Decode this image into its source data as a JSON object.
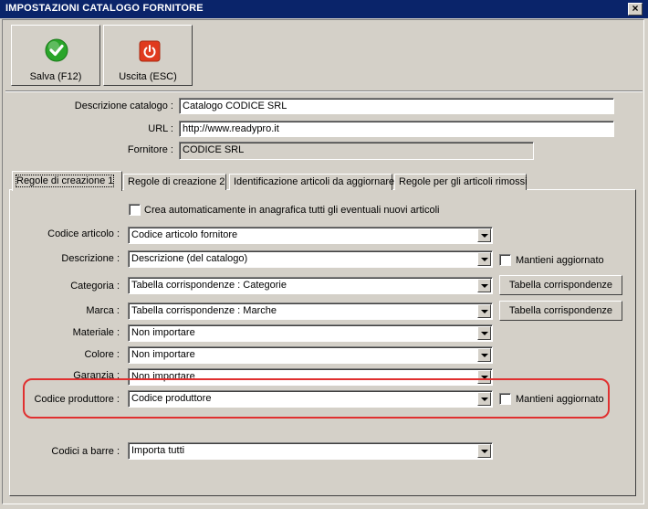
{
  "window": {
    "title": "IMPOSTAZIONI CATALOGO FORNITORE",
    "close_glyph": "×"
  },
  "toolbar": {
    "save_label": "Salva (F12)",
    "exit_label": "Uscita (ESC)",
    "save_icon": "check-icon",
    "exit_icon": "power-icon",
    "save_color": "#2aa52a",
    "exit_color": "#e03a1e"
  },
  "form": {
    "descrizione_label": "Descrizione catalogo :",
    "descrizione_value": "Catalogo CODICE SRL",
    "url_label": "URL :",
    "url_value": "http://www.readypro.it",
    "fornitore_label": "Fornitore :",
    "fornitore_value": "CODICE SRL"
  },
  "tabs": [
    {
      "label": "Regole di creazione 1",
      "active": true
    },
    {
      "label": "Regole di creazione 2",
      "active": false
    },
    {
      "label": "Identificazione articoli da aggiornare",
      "active": false
    },
    {
      "label": "Regole per gli articoli rimossi",
      "active": false
    }
  ],
  "panel": {
    "auto_create_label": "Crea automaticamente in anagrafica tutti gli eventuali nuovi articoli",
    "rows": [
      {
        "label": "Codice articolo :",
        "value": "Codice articolo fornitore"
      },
      {
        "label": "Descrizione :",
        "value": "Descrizione (del catalogo)",
        "side_check": "Mantieni aggiornato"
      },
      {
        "label": "Categoria :",
        "value": "Tabella corrispondenze : Categorie",
        "side_button": "Tabella corrispondenze"
      },
      {
        "label": "Marca :",
        "value": "Tabella corrispondenze : Marche",
        "side_button": "Tabella corrispondenze"
      },
      {
        "label": "Materiale :",
        "value": "Non importare"
      },
      {
        "label": "Colore :",
        "value": "Non importare"
      },
      {
        "label": "Garanzia :",
        "value": "Non importare"
      },
      {
        "label": "Codice produttore :",
        "value": "Codice produttore",
        "side_check": "Mantieni aggiornato"
      },
      {
        "label": "Codici a barre :",
        "value": "Importa tutti"
      }
    ],
    "highlight_color": "#e03030"
  }
}
